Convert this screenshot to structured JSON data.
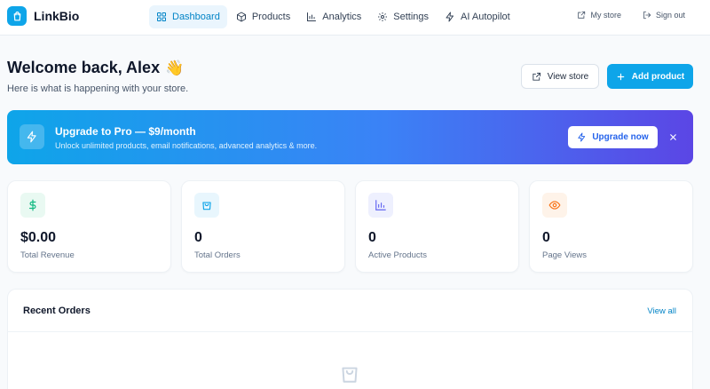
{
  "brand": {
    "name": "LinkBio",
    "icon": "shopping-bag-icon"
  },
  "nav": {
    "tabs": [
      {
        "label": "Dashboard",
        "icon": "grid-icon",
        "active": true
      },
      {
        "label": "Products",
        "icon": "box-icon",
        "active": false
      },
      {
        "label": "Analytics",
        "icon": "bar-chart-icon",
        "active": false
      },
      {
        "label": "Settings",
        "icon": "gear-icon",
        "active": false
      },
      {
        "label": "AI Autopilot",
        "icon": "zap-icon",
        "active": false
      }
    ],
    "right": [
      {
        "label": "My store",
        "icon": "external-link-icon"
      },
      {
        "label": "Sign out",
        "icon": "log-out-icon"
      }
    ]
  },
  "welcome": {
    "title": "Welcome back, Alex",
    "emoji": "👋",
    "subtitle": "Here is what is happening with your store."
  },
  "actions": {
    "view_store": "View store",
    "add_product": "Add product"
  },
  "banner": {
    "title": "Upgrade to Pro — $9/month",
    "subtitle": "Unlock unlimited products, email notifications, advanced analytics & more.",
    "button": "Upgrade now"
  },
  "stats": [
    {
      "value": "$0.00",
      "label": "Total Revenue",
      "icon": "dollar-icon",
      "color": "#10b981",
      "bg": "#e9f9f2"
    },
    {
      "value": "0",
      "label": "Total Orders",
      "icon": "shopping-bag-icon",
      "color": "#0ea5e9",
      "bg": "#e8f6fd"
    },
    {
      "value": "0",
      "label": "Active Products",
      "icon": "bar-chart-icon",
      "color": "#6366f1",
      "bg": "#eef0fe"
    },
    {
      "value": "0",
      "label": "Page Views",
      "icon": "eye-icon",
      "color": "#f97316",
      "bg": "#fef3e9"
    }
  ],
  "orders": {
    "title": "Recent Orders",
    "view_all": "View all"
  },
  "colors": {
    "accent": "#0ea5e9",
    "accent_dark": "#0284c7",
    "banner_end": "#5b46e5"
  }
}
